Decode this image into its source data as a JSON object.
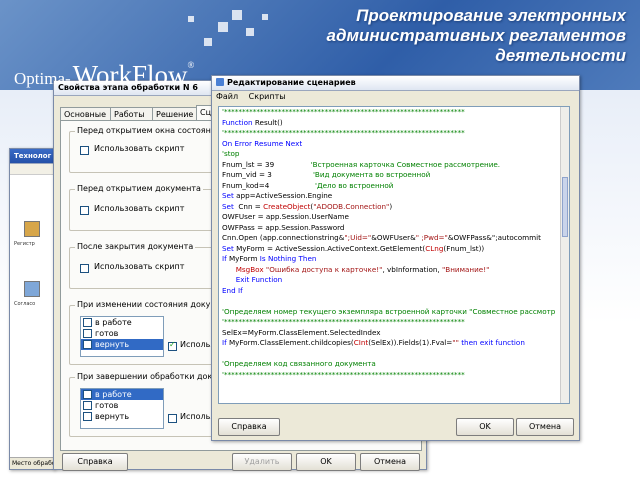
{
  "slide": {
    "title_lines": [
      "Проектирование электронных",
      "административных регламентов",
      "деятельности"
    ],
    "logo_prefix": "Optima-",
    "logo_brand": "WorkFlow",
    "logo_reg": "®"
  },
  "bg_window": {
    "title": "Технолог",
    "labels": [
      "Регистр",
      "Согласо"
    ],
    "status": "Место обрабо"
  },
  "stage_window": {
    "title": "Свойства этапа обработки N 6",
    "tabs": [
      "Основные",
      "Работы",
      "Решение",
      "Сц"
    ],
    "groups": {
      "before_open_state": {
        "label": "Перед открытием окна состояния д",
        "checkbox": "Использовать скрипт"
      },
      "before_open_doc": {
        "label": "Перед открытием документа",
        "checkbox": "Использовать скрипт"
      },
      "after_close_doc": {
        "label": "После закрытия документа",
        "checkbox": "Использовать скрипт"
      },
      "on_state_change": {
        "label": "При изменении состояния докумен",
        "items": [
          "в работе",
          "готов",
          "вернуть"
        ],
        "checkbox": "Использо"
      },
      "on_finish": {
        "label": "При завершении обработки докумен",
        "items": [
          "в работе",
          "готов",
          "вернуть"
        ],
        "checkbox": "Использо"
      }
    },
    "buttons": {
      "help": "Справка",
      "delete": "Удалить",
      "ok": "OK",
      "cancel": "Отмена"
    }
  },
  "editor_window": {
    "title": "Редактирование сценариев",
    "menu": [
      "Файл",
      "Скрипты"
    ],
    "code_lines": [
      "'*******************************************************************",
      "Function Result()",
      "'*******************************************************************",
      "On Error Resume Next",
      "'stop",
      "Fnum_lst = 39                'Встроенная карточка Совместное рассмотрение.",
      "Fnum_vid = 3                  'Вид документа во встроенной",
      "Fnum_kod=4                    'Дело во встроенной",
      "Set app=ActiveSession.Engine",
      "Set  Cnn = CreateObject(\"ADODB.Connection\")",
      "OWFUser = app.Session.UserName",
      "OWFPass = app.Session.Password",
      "Cnn.Open (app.connectionstring&\";Uid=\"&OWFUser&\" ;Pwd=\"&OWFPass&\";autocommit",
      "Set MyForm = ActiveSession.ActiveContext.GetElement(CLng(Fnum_lst))",
      "If MyForm Is Nothing Then",
      "      MsgBox \"Ошибка доступа к карточке!\", vbInformation, \"Внимание!\"",
      "      Exit Function",
      "End If",
      "",
      "'Определяем номер текущего экземпляра встроенной карточки \"Совместное рассмотр",
      "'*******************************************************************",
      "SelEx=MyForm.ClassElement.SelectedIndex",
      "If MyForm.ClassElement.childcopies(CInt(SelEx)).Fields(1).Fval=\"\" then exit function",
      "",
      "'Определяем код связанного документа",
      "'*******************************************************************",
      "",
      ""
    ],
    "buttons": {
      "help": "Справка",
      "ok": "OK",
      "cancel": "Отмена"
    }
  }
}
